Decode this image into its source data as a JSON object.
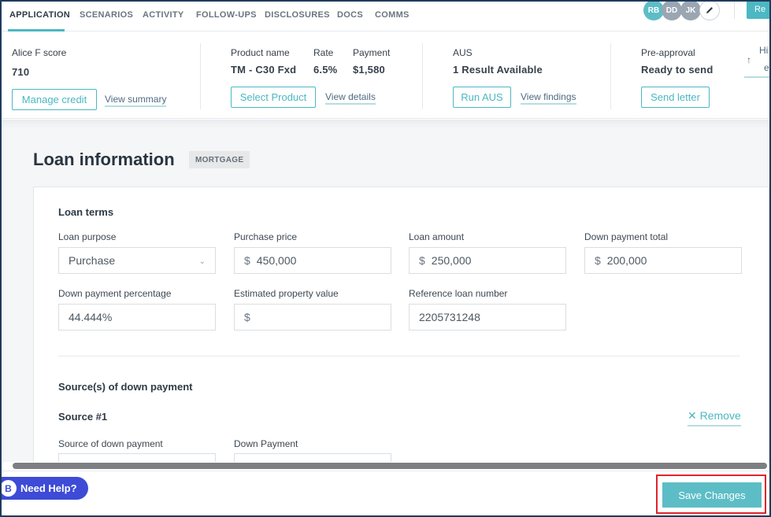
{
  "nav": {
    "tabs": [
      {
        "label": "APPLICATION"
      },
      {
        "label": "SCENARIOS"
      },
      {
        "label": "ACTIVITY"
      },
      {
        "label": "FOLLOW-UPS"
      },
      {
        "label": "DISCLOSURES"
      },
      {
        "label": "DOCS"
      },
      {
        "label": "COMMS"
      }
    ],
    "avatars": [
      {
        "initials": "RB",
        "color": "#5dbdc6"
      },
      {
        "initials": "DD",
        "color": "#9aa6b2"
      },
      {
        "initials": "JK",
        "color": "#9aa6b2"
      }
    ],
    "top_right_button": "Re"
  },
  "summary": {
    "credit": {
      "label": "Alice F score",
      "value": "710",
      "button": "Manage credit",
      "link": "View summary"
    },
    "product": {
      "name_label": "Product name",
      "name_value": "TM - C30 Fxd",
      "rate_label": "Rate",
      "rate_value": "6.5%",
      "payment_label": "Payment",
      "payment_value": "$1,580",
      "button": "Select Product",
      "link": "View details"
    },
    "aus": {
      "label": "AUS",
      "value": "1 Result Available",
      "button": "Run AUS",
      "link": "View findings"
    },
    "preapproval": {
      "label": "Pre-approval",
      "value": "Ready to send",
      "button": "Send letter"
    },
    "extra": {
      "line1": "Hi",
      "line2": "e"
    }
  },
  "main": {
    "title": "Loan information",
    "badge": "MORTGAGE",
    "loan_terms": {
      "title": "Loan terms",
      "loan_purpose": {
        "label": "Loan purpose",
        "value": "Purchase"
      },
      "purchase_price": {
        "label": "Purchase price",
        "currency": "$",
        "value": "450,000"
      },
      "loan_amount": {
        "label": "Loan amount",
        "currency": "$",
        "value": "250,000"
      },
      "down_payment_total": {
        "label": "Down payment total",
        "currency": "$",
        "value": "200,000"
      },
      "down_payment_percentage": {
        "label": "Down payment percentage",
        "value": "44.444%"
      },
      "estimated_property_value": {
        "label": "Estimated property value",
        "currency": "$",
        "value": ""
      },
      "reference_loan_number": {
        "label": "Reference loan number",
        "value": "2205731248"
      }
    },
    "down_payment_sources": {
      "title": "Source(s) of down payment",
      "source_title": "Source #1",
      "remove_label": "✕ Remove",
      "source_label": "Source of down payment",
      "amount_label": "Down Payment"
    }
  },
  "footer": {
    "help_label": "Need Help?",
    "help_logo": "B",
    "save_label": "Save Changes"
  },
  "colors": {
    "accent": "#4bb8c2",
    "help": "#3d4bd6",
    "highlight": "#e0242b"
  }
}
